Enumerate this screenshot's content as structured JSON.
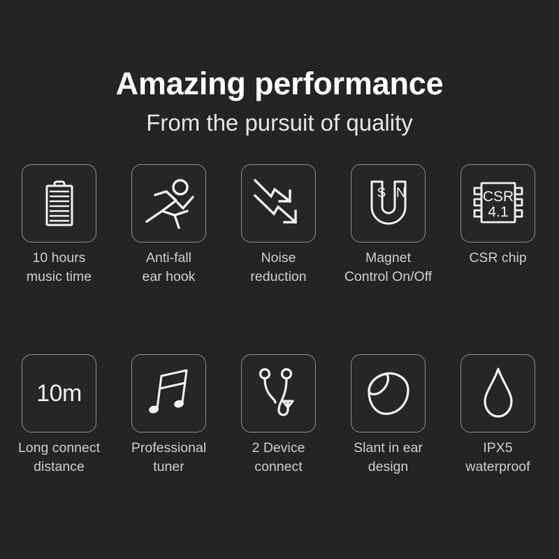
{
  "page": {
    "background_color": "#242424",
    "text_color": "#cfcfcf",
    "stroke_color": "#f2f2f2",
    "box_border_color": "#8e8e8e"
  },
  "header": {
    "title": "Amazing performance",
    "subtitle": "From the pursuit of quality"
  },
  "features": {
    "row1": [
      {
        "icon": "battery-icon",
        "label": "10 hours\nmusic time"
      },
      {
        "icon": "running-person-icon",
        "label": "Anti-fall\near hook"
      },
      {
        "icon": "descending-arrows-icon",
        "label": "Noise\nreduction"
      },
      {
        "icon": "horseshoe-magnet-icon",
        "label": "Magnet\nControl On/Off",
        "pole_left": "S",
        "pole_right": "N"
      },
      {
        "icon": "chip-icon",
        "label": "CSR chip",
        "chip_line1": "CSR",
        "chip_line2": "4.1"
      }
    ],
    "row2": [
      {
        "icon": "distance-text-icon",
        "label": "Long connect\ndistance",
        "value": "10m"
      },
      {
        "icon": "music-note-icon",
        "label": "Professional\ntuner"
      },
      {
        "icon": "dual-device-icon",
        "label": "2 Device\nconnect"
      },
      {
        "icon": "ear-tip-icon",
        "label": "Slant in ear\ndesign"
      },
      {
        "icon": "water-drop-icon",
        "label": "IPX5\nwaterproof"
      }
    ]
  }
}
